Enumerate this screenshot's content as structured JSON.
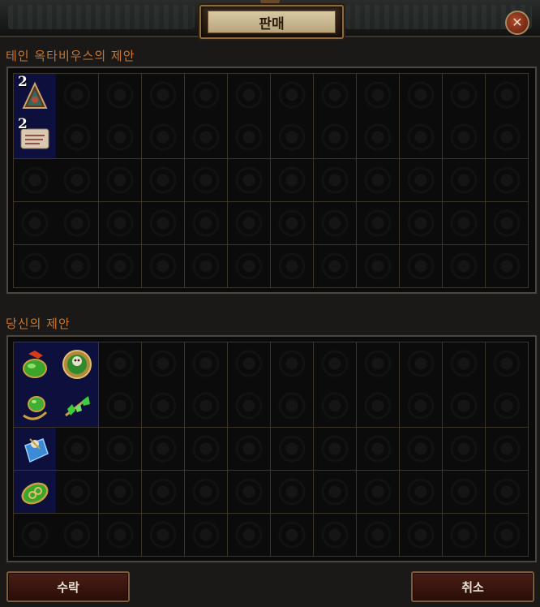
{
  "window": {
    "title": "판매",
    "close_icon": "close-icon"
  },
  "their_offer": {
    "label": "테인 옥타비우스의 제안",
    "rows": 5,
    "cols": 12,
    "items": [
      {
        "icon": "divination-card-icon",
        "row": 0,
        "col": 0,
        "stack": "2"
      },
      {
        "icon": "scroll-icon",
        "row": 1,
        "col": 0,
        "stack": "2"
      }
    ]
  },
  "your_offer": {
    "label": "당신의 제안",
    "rows": 5,
    "cols": 12,
    "items": [
      {
        "icon": "green-gem-flame-icon",
        "row": 0,
        "col": 0,
        "stack": ""
      },
      {
        "icon": "green-skull-amulet-icon",
        "row": 0,
        "col": 1,
        "stack": ""
      },
      {
        "icon": "green-gold-ring-icon",
        "row": 1,
        "col": 0,
        "stack": ""
      },
      {
        "icon": "green-crystal-branch-icon",
        "row": 1,
        "col": 1,
        "stack": ""
      },
      {
        "icon": "blue-skull-gem-icon",
        "row": 2,
        "col": 0,
        "stack": ""
      },
      {
        "icon": "green-gold-ring-2-icon",
        "row": 3,
        "col": 0,
        "stack": ""
      }
    ]
  },
  "buttons": {
    "accept": "수락",
    "cancel": "취소"
  },
  "colors": {
    "accent": "#c8762e",
    "filled_cell": "#0d0f3c"
  }
}
